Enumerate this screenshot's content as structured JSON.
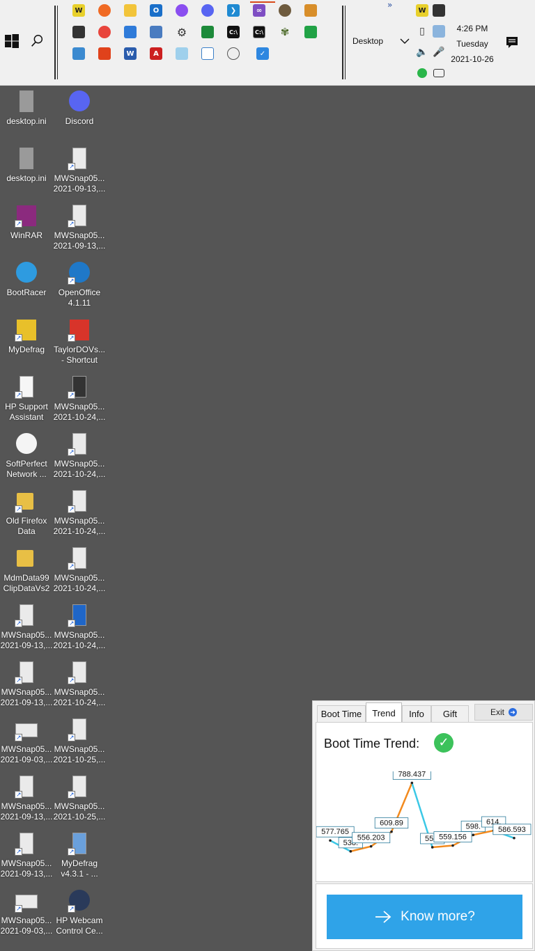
{
  "taskbar": {
    "desktop_label": "Desktop",
    "overflow_glyph": "»",
    "clock": {
      "time": "4:26 PM",
      "day": "Tuesday",
      "date": "2021-10-26"
    }
  },
  "desktop": {
    "icons": [
      {
        "name": "desktop.ini",
        "line2": ""
      },
      {
        "name": "Discord",
        "line2": ""
      },
      {
        "name": "desktop.ini",
        "line2": ""
      },
      {
        "name": "MWSnap05...",
        "line2": "2021-09-13,..."
      },
      {
        "name": "WinRAR",
        "line2": ""
      },
      {
        "name": "MWSnap05...",
        "line2": "2021-09-13,..."
      },
      {
        "name": "BootRacer",
        "line2": ""
      },
      {
        "name": "OpenOffice",
        "line2": "4.1.11"
      },
      {
        "name": "MyDefrag",
        "line2": ""
      },
      {
        "name": "TaylorDOVs...",
        "line2": "- Shortcut"
      },
      {
        "name": "HP Support",
        "line2": "Assistant"
      },
      {
        "name": "MWSnap05...",
        "line2": "2021-10-24,..."
      },
      {
        "name": "SoftPerfect",
        "line2": "Network ..."
      },
      {
        "name": "MWSnap05...",
        "line2": "2021-10-24,..."
      },
      {
        "name": "Old Firefox",
        "line2": "Data"
      },
      {
        "name": "MWSnap05...",
        "line2": "2021-10-24,..."
      },
      {
        "name": "MdmData99",
        "line2": "ClipDataVs2"
      },
      {
        "name": "MWSnap05...",
        "line2": "2021-10-24,..."
      },
      {
        "name": "MWSnap05...",
        "line2": "2021-09-13,..."
      },
      {
        "name": "MWSnap05...",
        "line2": "2021-10-24,..."
      },
      {
        "name": "MWSnap05...",
        "line2": "2021-09-13,..."
      },
      {
        "name": "MWSnap05...",
        "line2": "2021-10-24,..."
      },
      {
        "name": "MWSnap05...",
        "line2": "2021-09-03,..."
      },
      {
        "name": "MWSnap05...",
        "line2": "2021-10-25,..."
      },
      {
        "name": "MWSnap05...",
        "line2": "2021-09-13,..."
      },
      {
        "name": "MWSnap05...",
        "line2": "2021-10-25,..."
      },
      {
        "name": "MWSnap05...",
        "line2": "2021-09-13,..."
      },
      {
        "name": "MyDefrag",
        "line2": "v4.3.1 - ..."
      },
      {
        "name": "MWSnap05...",
        "line2": "2021-09-03,..."
      },
      {
        "name": "HP Webcam",
        "line2": "Control Ce..."
      }
    ]
  },
  "widget": {
    "tabs": [
      "Boot Time",
      "Trend",
      "Info",
      "Gift"
    ],
    "active_tab": "Trend",
    "exit_label": "Exit",
    "title": "Boot Time Trend:",
    "know_more_label": "Know more?"
  },
  "chart_data": {
    "type": "line",
    "x": [
      1,
      2,
      3,
      4,
      5,
      6,
      7,
      8,
      9,
      10
    ],
    "values": [
      577.765,
      538.0,
      556.203,
      609.89,
      788.437,
      553.0,
      559.156,
      598.0,
      614.0,
      586.593
    ],
    "labels": [
      "577.765",
      "538.",
      "556.203",
      "609.89",
      "788.437",
      "553.",
      "559.156",
      "598.",
      "614.",
      "586.593"
    ],
    "colors": {
      "up": "#f28a1e",
      "down": "#3cc8e6"
    }
  }
}
